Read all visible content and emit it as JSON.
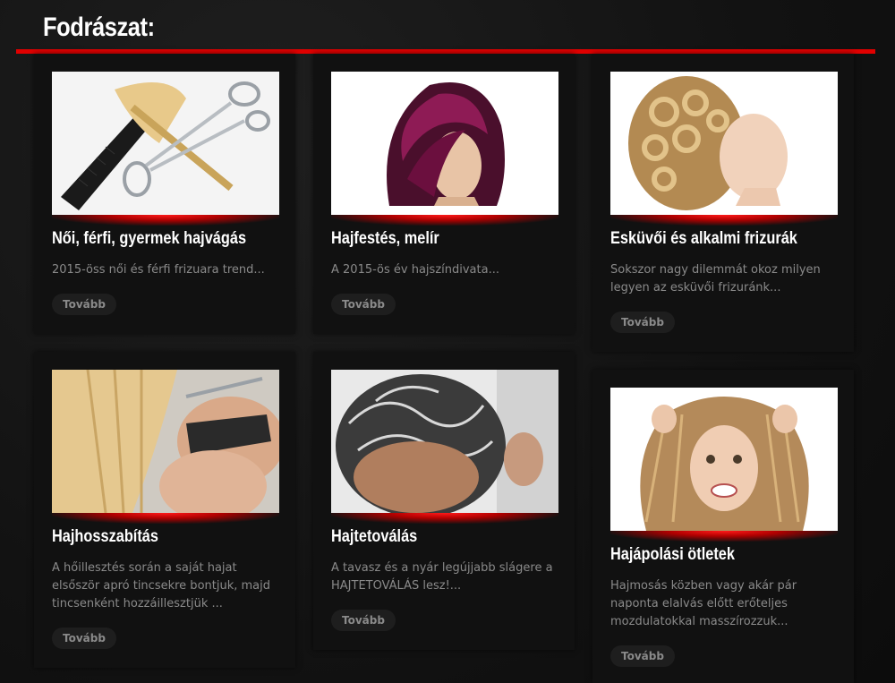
{
  "header": {
    "title": "Fodrászat:"
  },
  "accent_color": "#e00000",
  "cards": [
    {
      "title": "Női, férfi, gyermek hajvágás",
      "description": "2015-öss női és férfi frizuara trend...",
      "button": "Tovább",
      "image": "scissors-comb-image"
    },
    {
      "title": "Hajfestés, melír",
      "description": "A 2015-ös év hajszíndivata...",
      "button": "Tovább",
      "image": "purple-hair-woman-image"
    },
    {
      "title": "Esküvői és alkalmi frizurák",
      "description": "Sokszor nagy dilemmát okoz milyen legyen az esküvői frizuránk...",
      "button": "Tovább",
      "image": "curly-updo-image"
    },
    {
      "title": "Hajhosszabítás",
      "description": "A hőillesztés során a saját hajat elsőször apró tincsekre bontjuk, majd tincsenként hozzáillesztjük ...",
      "button": "Tovább",
      "image": "hair-extension-image"
    },
    {
      "title": "Hajtetoválás",
      "description": "A tavasz és a nyár legújjabb slágere a HAJTETOVÁLÁS lesz!...",
      "button": "Tovább",
      "image": "hair-tattoo-image"
    },
    {
      "title": "Hajápolási ötletek",
      "description": "Hajmosás közben vagy akár pár naponta elalvás előtt erőteljes mozdulatokkal masszírozzuk...",
      "button": "Tovább",
      "image": "frustrated-woman-hair-image"
    }
  ]
}
